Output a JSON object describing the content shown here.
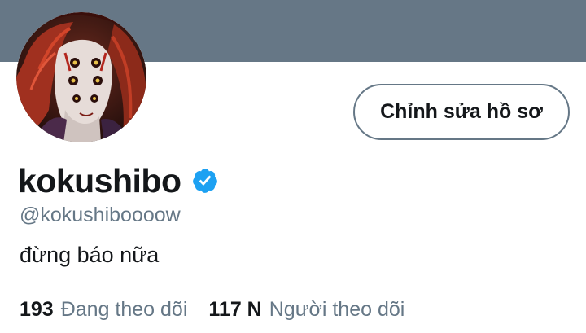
{
  "profile": {
    "display_name": "kokushibo",
    "handle": "@kokushiboooow",
    "bio": "đừng báo nữa",
    "verified": true,
    "avatar_icon": "avatar-portrait",
    "verified_icon": "verified-badge-icon"
  },
  "actions": {
    "edit_label": "Chỉnh sửa hồ sơ"
  },
  "stats": {
    "following_count": "193",
    "following_label": "Đang theo dõi",
    "followers_count": "117 N",
    "followers_label": "Người theo dõi"
  },
  "colors": {
    "banner": "#667786",
    "text_primary": "#14171a",
    "text_secondary": "#657786",
    "verified_badge": "#1da1f2"
  }
}
